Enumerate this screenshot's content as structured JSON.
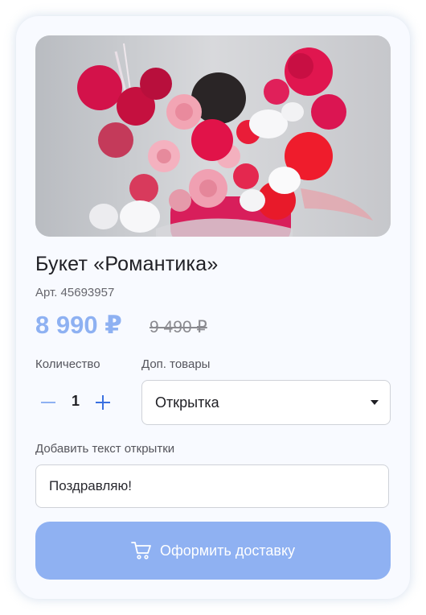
{
  "product": {
    "image_alt": "Букет «Романтика»",
    "title": "Букет «Романтика»",
    "sku": "Арт. 45693957",
    "price": "8 990 ₽",
    "old_price": "9 490 ₽"
  },
  "quantity": {
    "label": "Количество",
    "value": "1"
  },
  "extras": {
    "label": "Доп. товары",
    "selected": "Открытка"
  },
  "card_text": {
    "label": "Добавить текст открытки",
    "value": "Поздравляю!"
  },
  "checkout": {
    "label": "Оформить доставку"
  },
  "colors": {
    "accent": "#8fb1f2",
    "price": "#8eb1f2",
    "card_bg": "#f8faff"
  },
  "icons": {
    "minus": "minus-icon",
    "plus": "plus-icon",
    "caret": "caret-down-icon",
    "cart": "cart-icon"
  }
}
